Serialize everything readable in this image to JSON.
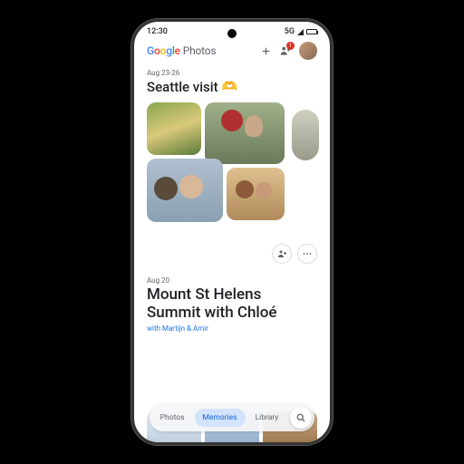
{
  "status": {
    "time": "12:30",
    "network": "5G"
  },
  "header": {
    "app_name_photos": "Photos",
    "share_badge": "1"
  },
  "memory1": {
    "date": "Aug 23-26",
    "title": "Seattle visit",
    "emoji": "🫶"
  },
  "memory2": {
    "date": "Aug 20",
    "title_line1": "Mount St Helens",
    "title_line2": "Summit with Chloé",
    "with": "with Martijn & Amir"
  },
  "nav": {
    "items": [
      "Photos",
      "Memories",
      "Library"
    ],
    "active_index": 1
  }
}
